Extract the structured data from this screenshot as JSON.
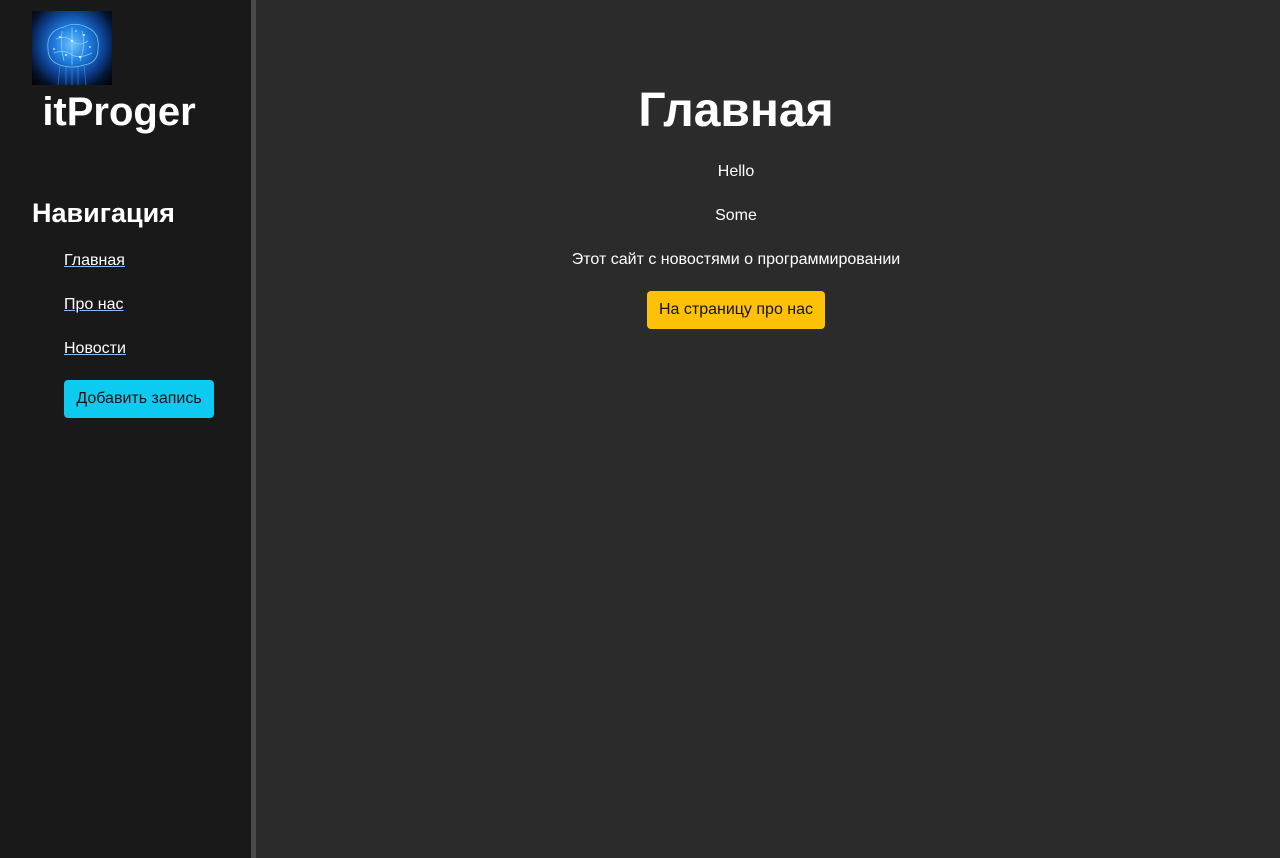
{
  "sidebar": {
    "logo_icon": "brain-icon",
    "brand": "itProger",
    "nav_title": "Навигация",
    "links": [
      {
        "label": "Главная"
      },
      {
        "label": "Про нас"
      },
      {
        "label": "Новости"
      }
    ],
    "add_button": "Добавить запись",
    "add_button_color": "#0dcaf0"
  },
  "main": {
    "title": "Главная",
    "paragraphs": [
      "Hello",
      "Some",
      "Этот сайт с новостями о программировании"
    ],
    "about_button": "На страницу про нас",
    "about_button_color": "#ffc107"
  }
}
